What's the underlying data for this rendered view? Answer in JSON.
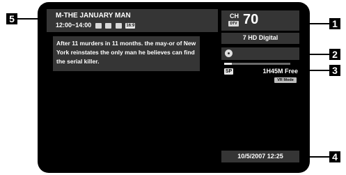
{
  "callouts": [
    "1",
    "2",
    "3",
    "4",
    "5"
  ],
  "program": {
    "title": "M-THE JANUARY MAN",
    "time": "12:00~14:00",
    "format_badge": "16:9",
    "description": "After 11 murders in 11 months. the may-or of New York reinstates the only man he believes can find the serial killer."
  },
  "channel": {
    "ch_label": "CH",
    "dtv_badge": "DTV",
    "number": "70",
    "name": "7 HD Digital"
  },
  "disc": {
    "icon": "disc-icon",
    "mode_badge": "SP",
    "free_time": "1H45M Free",
    "vr_badge": "VR Mode",
    "usage_fraction": 0.12
  },
  "datetime": "10/5/2007 12:25",
  "colors": {
    "screen": "#000000",
    "panel": "#353535",
    "text": "#ffffff"
  }
}
